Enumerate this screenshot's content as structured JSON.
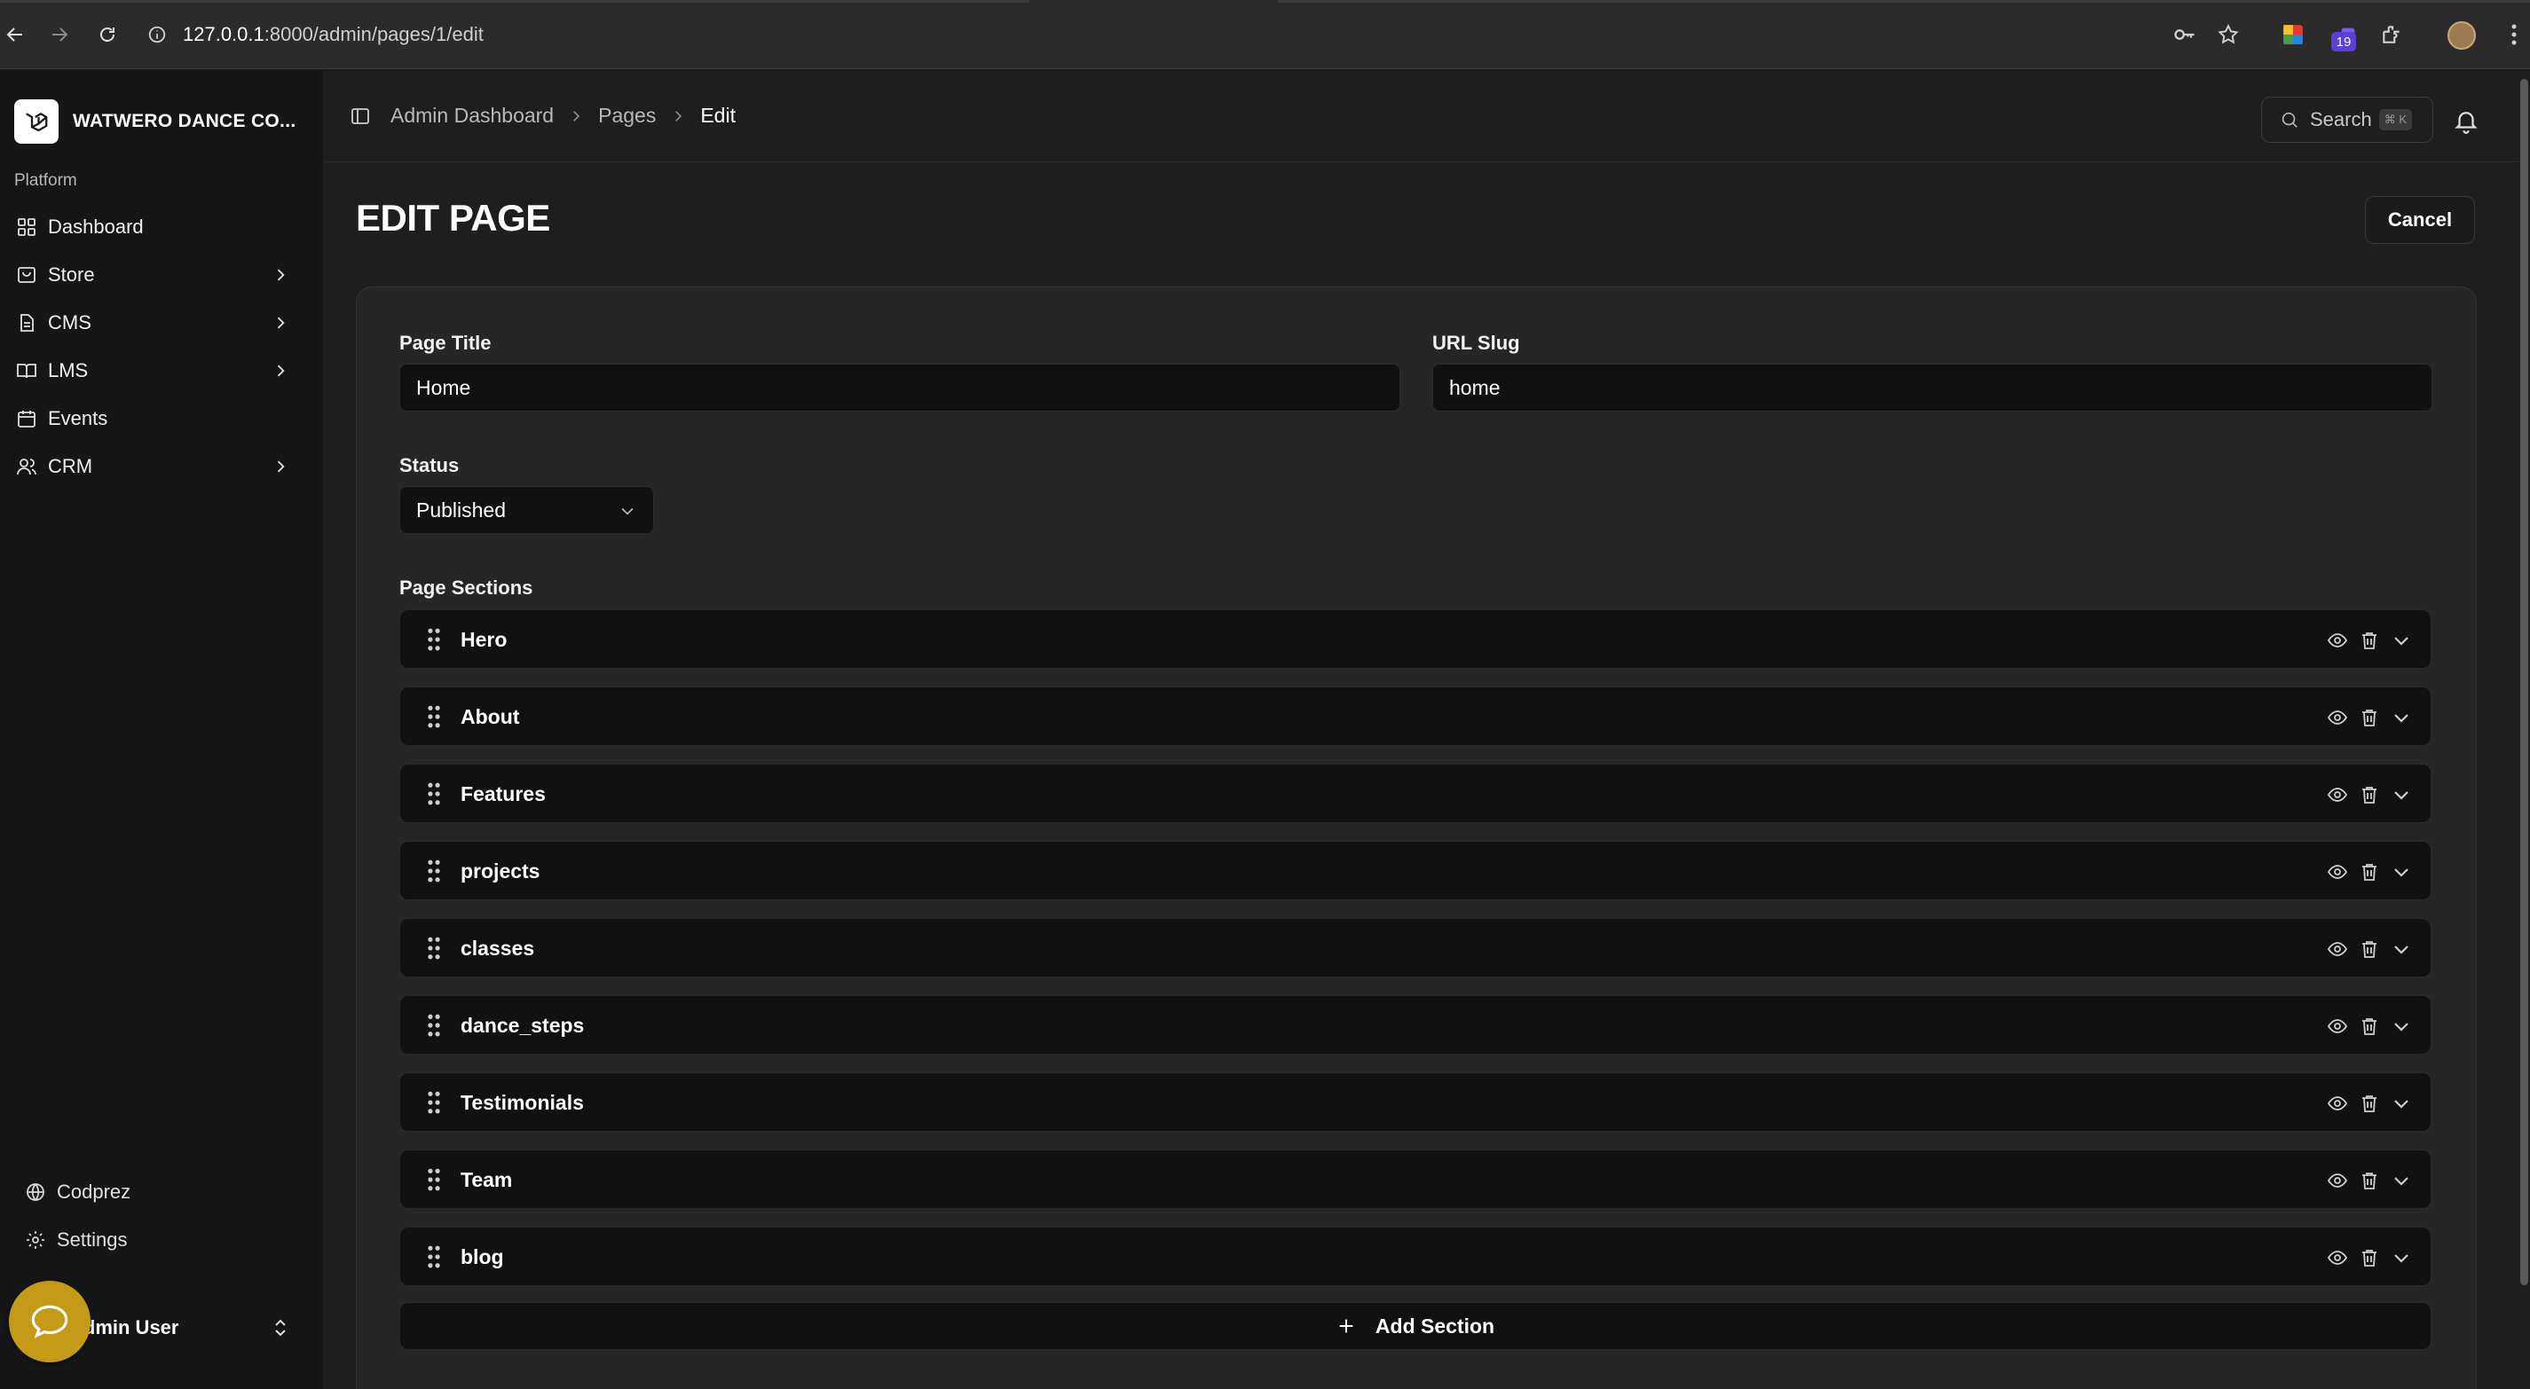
{
  "browser": {
    "url_host": "127.0.0.1",
    "url_path": ":8000/admin/pages/1/edit",
    "extension_badge": "19"
  },
  "sidebar": {
    "brand_name": "WATWERO DANCE CO...",
    "group_label": "Platform",
    "items": [
      {
        "label": "Dashboard",
        "icon": "grid-icon",
        "expandable": false
      },
      {
        "label": "Store",
        "icon": "store-icon",
        "expandable": true
      },
      {
        "label": "CMS",
        "icon": "document-icon",
        "expandable": true
      },
      {
        "label": "LMS",
        "icon": "book-icon",
        "expandable": true
      },
      {
        "label": "Events",
        "icon": "calendar-icon",
        "expandable": false
      },
      {
        "label": "CRM",
        "icon": "users-icon",
        "expandable": true
      }
    ],
    "bottom_items": [
      {
        "label": "Codprez",
        "icon": "globe-icon"
      },
      {
        "label": "Settings",
        "icon": "gear-icon"
      }
    ],
    "user_name": "Admin User"
  },
  "header": {
    "breadcrumbs": [
      "Admin Dashboard",
      "Pages",
      "Edit"
    ],
    "search_label": "Search",
    "search_shortcut": "⌘ K"
  },
  "page": {
    "title": "EDIT PAGE",
    "cancel_label": "Cancel",
    "fields": {
      "page_title_label": "Page Title",
      "page_title_value": "Home",
      "url_slug_label": "URL Slug",
      "url_slug_value": "home",
      "status_label": "Status",
      "status_value": "Published"
    },
    "sections_label": "Page Sections",
    "sections": [
      {
        "name": "Hero"
      },
      {
        "name": "About"
      },
      {
        "name": "Features"
      },
      {
        "name": "projects"
      },
      {
        "name": "classes"
      },
      {
        "name": "dance_steps"
      },
      {
        "name": "Testimonials"
      },
      {
        "name": "Team"
      },
      {
        "name": "blog"
      }
    ],
    "add_section_label": "Add Section"
  },
  "colors": {
    "background": "#1a1a1a",
    "sidebar": "#161616",
    "card": "#262626",
    "input": "#111111",
    "chat_bubble": "#c49a16"
  }
}
